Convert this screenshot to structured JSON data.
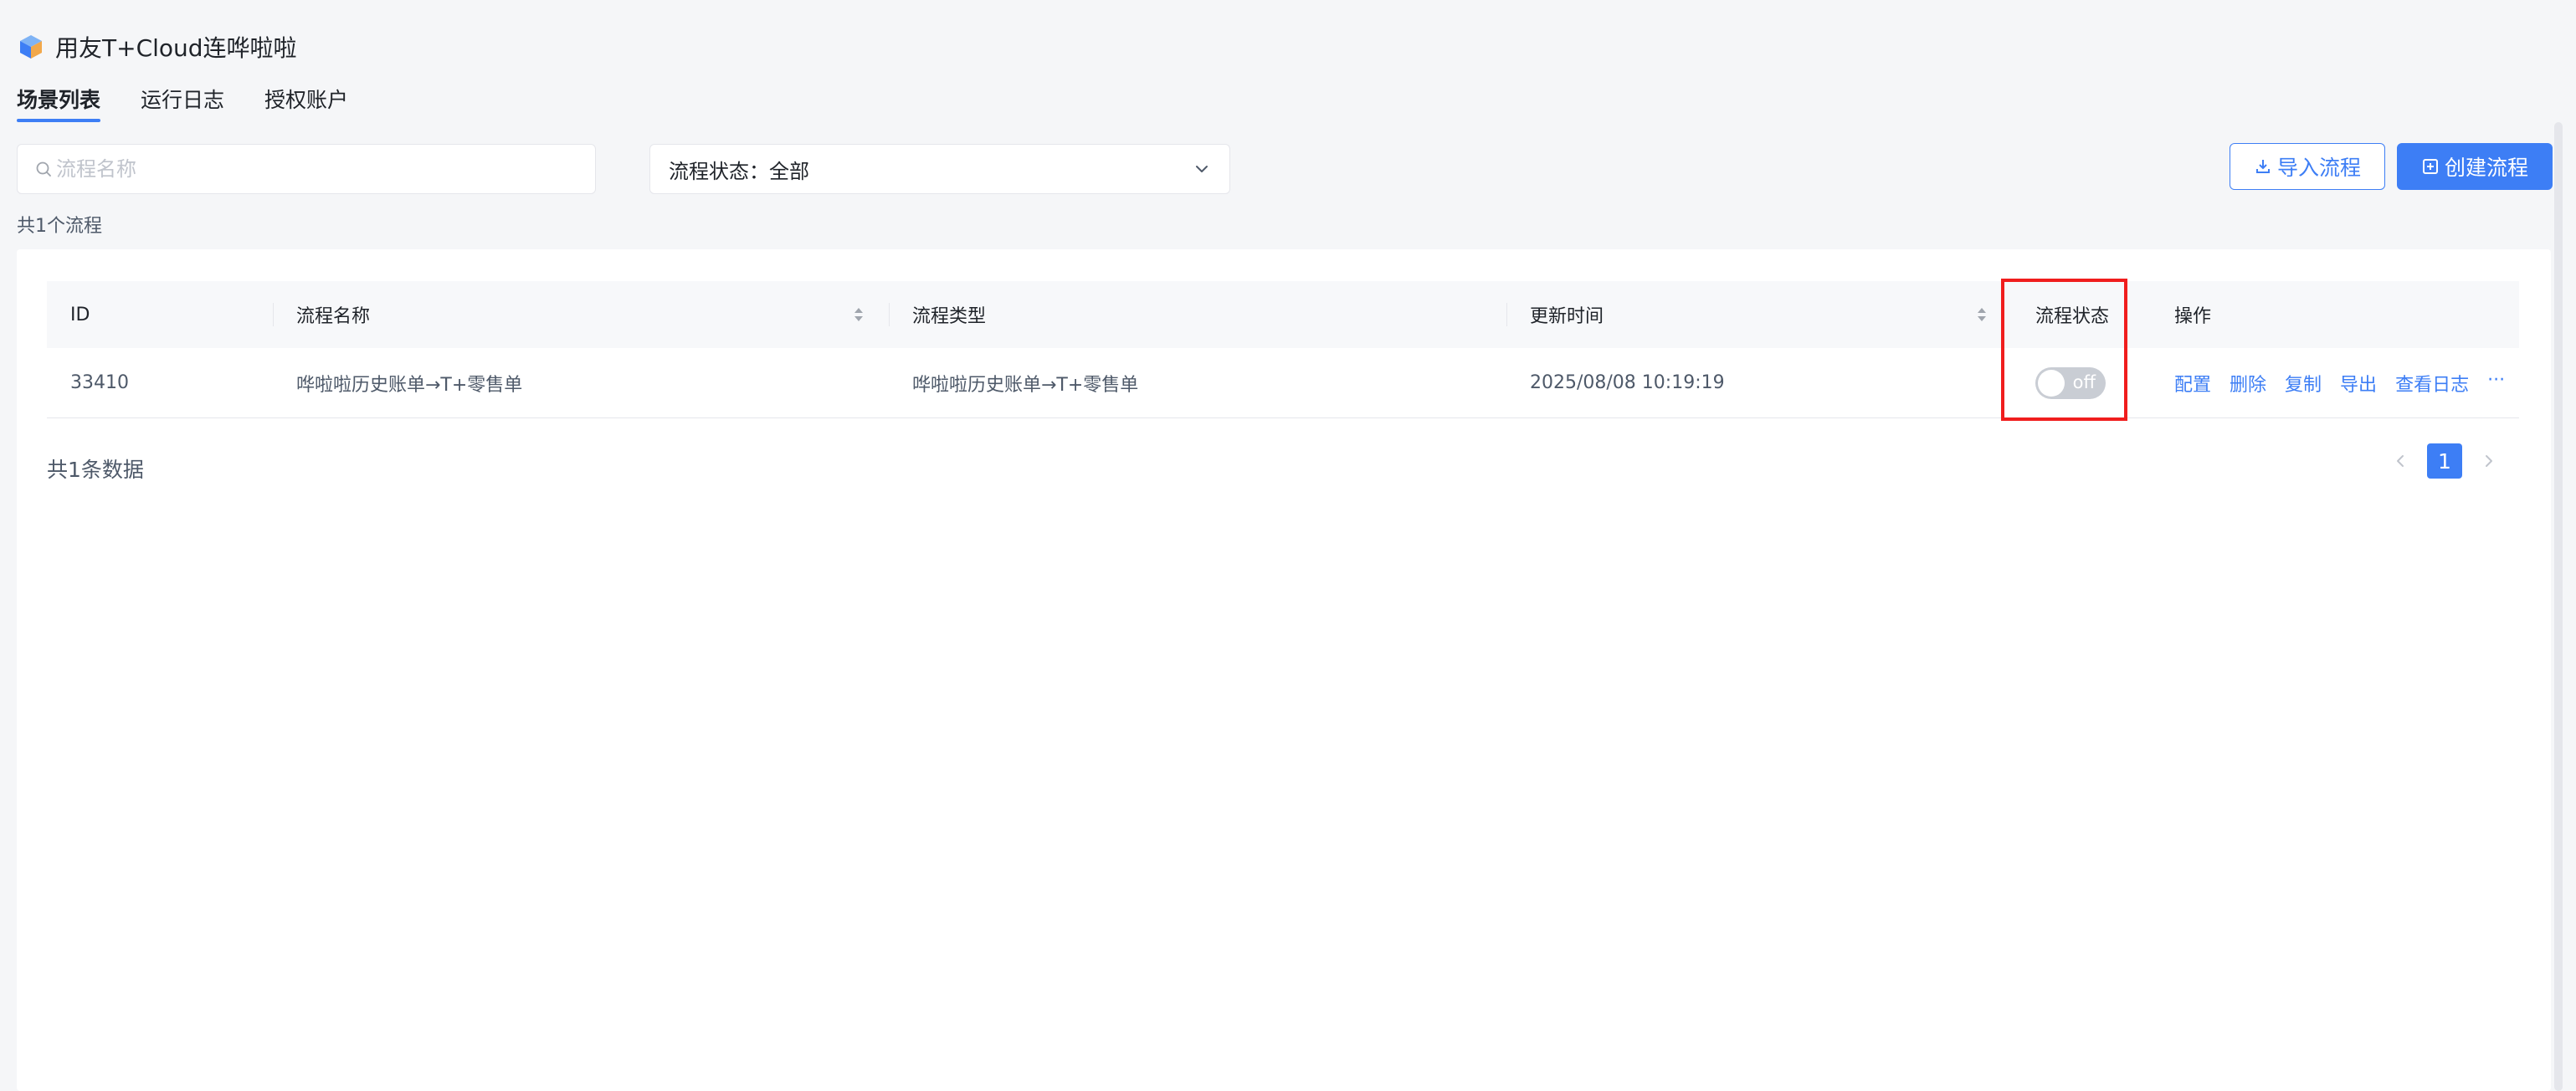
{
  "app": {
    "title": "用友T+Cloud连哗啦啦",
    "logo_icon": "cube-logo-icon"
  },
  "tabs": [
    {
      "label": "场景列表",
      "active": true
    },
    {
      "label": "运行日志",
      "active": false
    },
    {
      "label": "授权账户",
      "active": false
    }
  ],
  "toolbar": {
    "search_placeholder": "流程名称",
    "status_filter_label": "流程状态：全部",
    "import_label": "导入流程",
    "create_label": "创建流程"
  },
  "summary": {
    "total_flows": "共1个流程",
    "total_rows": "共1条数据"
  },
  "table": {
    "headers": {
      "id": "ID",
      "name": "流程名称",
      "type": "流程类型",
      "updated": "更新时间",
      "status": "流程状态",
      "ops": "操作"
    },
    "rows": [
      {
        "id": "33410",
        "name": "哗啦啦历史账单→T+零售单",
        "type": "哗啦啦历史账单→T+零售单",
        "updated": "2025/08/08 10:19:19",
        "status_text": "off",
        "enabled": false
      }
    ],
    "row_actions": [
      "配置",
      "删除",
      "复制",
      "导出",
      "查看日志",
      "···"
    ]
  },
  "pagination": {
    "current": "1"
  },
  "colors": {
    "accent": "#3d7ef5",
    "highlight": "#f01d1d",
    "switch_off": "#c9cdd4"
  }
}
